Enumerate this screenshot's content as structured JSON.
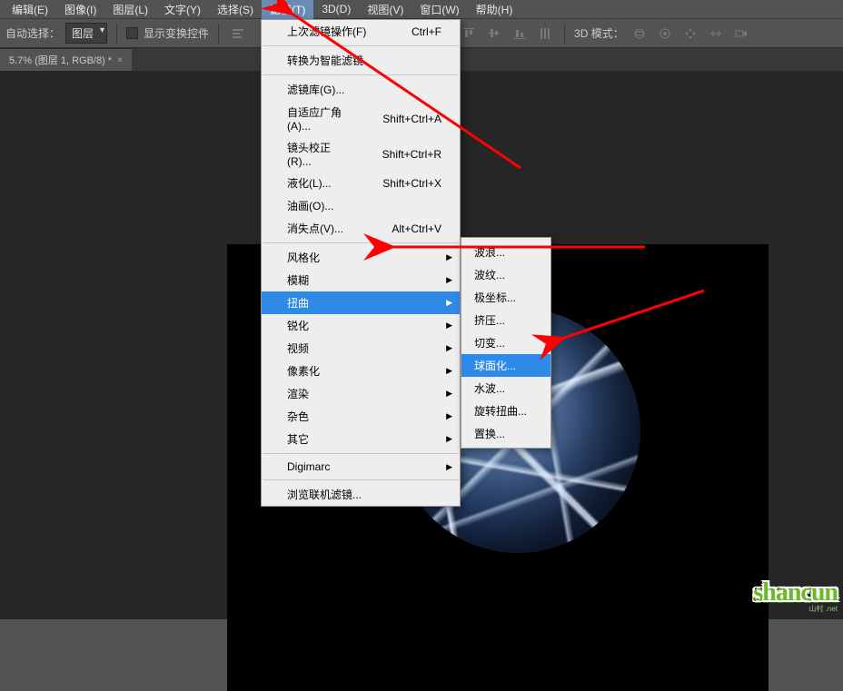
{
  "menubar": {
    "items": [
      "编辑(E)",
      "图像(I)",
      "图层(L)",
      "文字(Y)",
      "选择(S)",
      "滤镜(T)",
      "3D(D)",
      "视图(V)",
      "窗口(W)",
      "帮助(H)"
    ],
    "activeIndex": 5
  },
  "toolbar": {
    "autoSelectLabel": "自动选择：",
    "layerSelect": "图层",
    "showTransformLabel": "显示变换控件",
    "mode3dLabel": "3D 模式："
  },
  "tab": {
    "title": "5.7% (图层 1, RGB/8) *"
  },
  "filterMenu": {
    "lastFilter": {
      "label": "上次滤镜操作(F)",
      "shortcut": "Ctrl+F"
    },
    "convertSmart": {
      "label": "转换为智能滤镜"
    },
    "filterGallery": {
      "label": "滤镜库(G)..."
    },
    "adaptiveWide": {
      "label": "自适应广角(A)...",
      "shortcut": "Shift+Ctrl+A"
    },
    "lensCorrection": {
      "label": "镜头校正(R)...",
      "shortcut": "Shift+Ctrl+R"
    },
    "liquify": {
      "label": "液化(L)...",
      "shortcut": "Shift+Ctrl+X"
    },
    "oilPaint": {
      "label": "油画(O)..."
    },
    "vanishingPoint": {
      "label": "消失点(V)...",
      "shortcut": "Alt+Ctrl+V"
    },
    "stylize": {
      "label": "风格化"
    },
    "blur": {
      "label": "模糊"
    },
    "distort": {
      "label": "扭曲"
    },
    "sharpen": {
      "label": "锐化"
    },
    "video": {
      "label": "视频"
    },
    "pixelate": {
      "label": "像素化"
    },
    "render": {
      "label": "渲染"
    },
    "noise": {
      "label": "杂色"
    },
    "other": {
      "label": "其它"
    },
    "digimarc": {
      "label": "Digimarc"
    },
    "browseOnline": {
      "label": "浏览联机滤镜..."
    }
  },
  "distortSubmenu": {
    "wave": "波浪...",
    "ripple": "波纹...",
    "polar": "极坐标...",
    "pinch": "挤压...",
    "shear": "切变...",
    "spherize": "球面化...",
    "zigzag": "水波...",
    "twirl": "旋转扭曲...",
    "displace": "置换..."
  },
  "watermark": {
    "text": "shancun",
    "sub": "山村 .net"
  }
}
